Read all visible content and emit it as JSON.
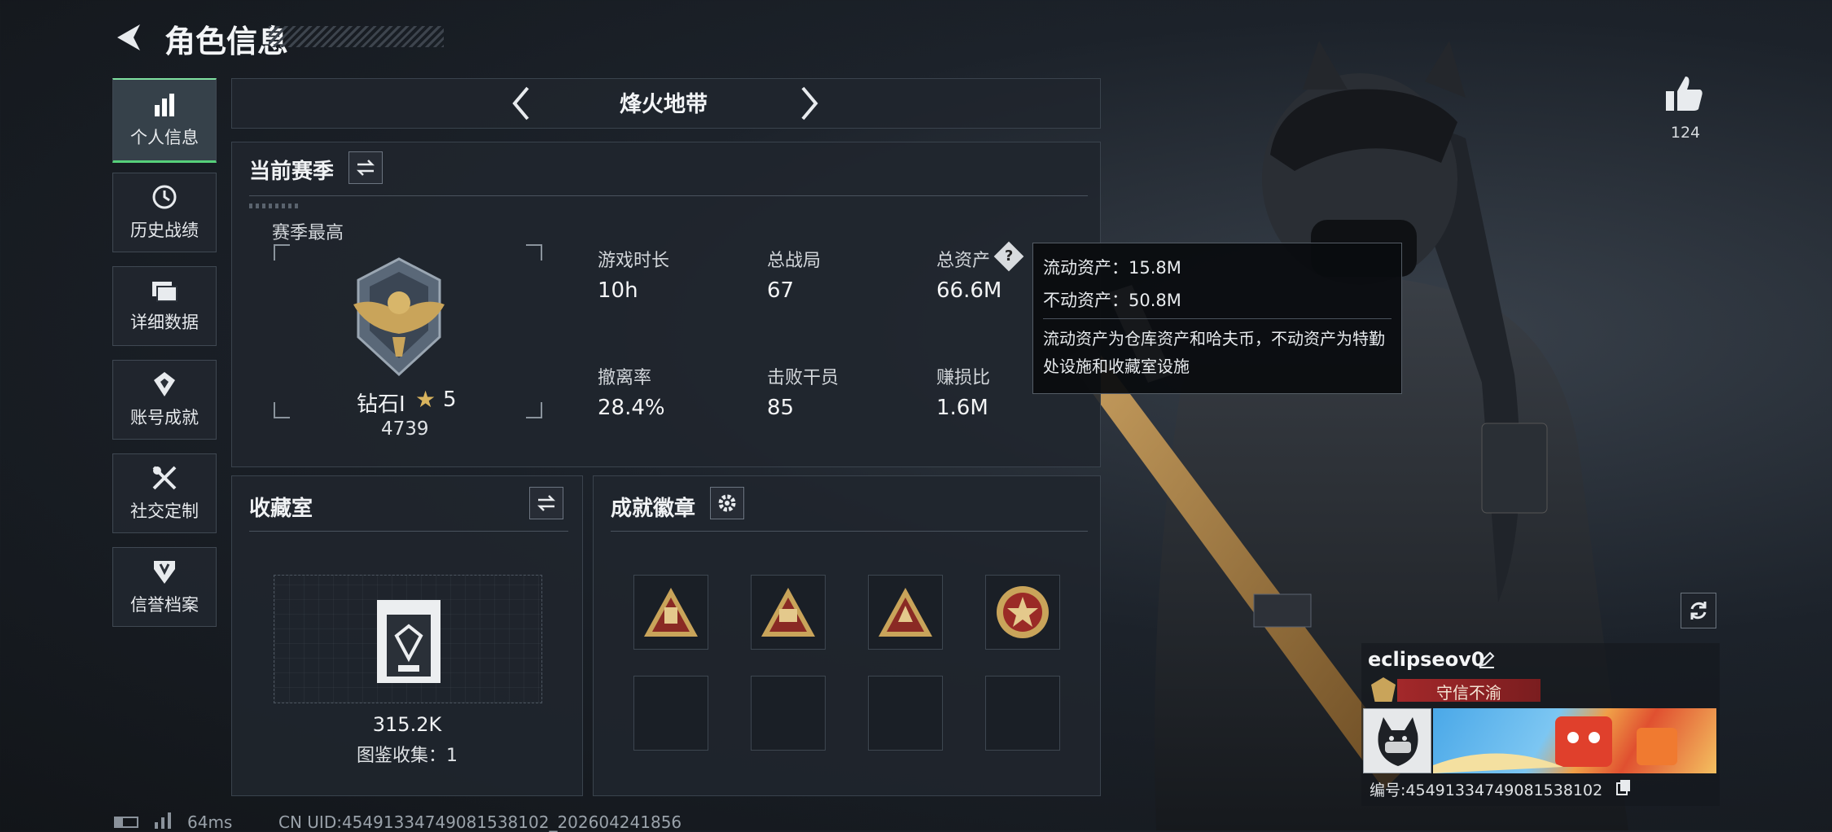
{
  "header": {
    "title": "角色信息"
  },
  "sidebar": {
    "items": [
      {
        "label": "个人信息",
        "icon": "bar-chart-icon",
        "active": true
      },
      {
        "label": "历史战绩",
        "icon": "history-icon"
      },
      {
        "label": "详细数据",
        "icon": "folder-icon"
      },
      {
        "label": "账号成就",
        "icon": "achievement-icon"
      },
      {
        "label": "社交定制",
        "icon": "tools-icon"
      },
      {
        "label": "信誉档案",
        "icon": "shield-icon"
      }
    ]
  },
  "mode_selector": {
    "label": "烽火地带"
  },
  "season": {
    "title": "当前赛季",
    "peak_label": "赛季最高",
    "rank": "钻石Ⅰ",
    "stars": "5",
    "score": "4739",
    "stats": [
      {
        "label": "游戏时长",
        "value": "10h"
      },
      {
        "label": "总战局",
        "value": "67"
      },
      {
        "label": "总资产",
        "value": "66.6M"
      },
      {
        "label": "撤离率",
        "value": "28.4%"
      },
      {
        "label": "击败干员",
        "value": "85"
      },
      {
        "label": "赚损比",
        "value": "1.6M"
      }
    ]
  },
  "tooltip": {
    "liquid": "流动资产：15.8M",
    "fixed": "不动资产：50.8M",
    "desc": "流动资产为仓库资产和哈夫币，不动资产为特勤处设施和收藏室设施"
  },
  "collection": {
    "title": "收藏室",
    "value": "315.2K",
    "count_label": "图鉴收集：1"
  },
  "badges": {
    "title": "成就徽章"
  },
  "likes": {
    "count": "124"
  },
  "player": {
    "name": "eclipseov0",
    "title": "守信不渝",
    "id_label": "编号:45491334749081538102"
  },
  "footer": {
    "ping": "64ms",
    "uid": "CN UID:45491334749081538102_202604241856"
  },
  "colors": {
    "accent_green": "#56d07a",
    "title_red": "#a3282a",
    "bg": "#1c222a"
  }
}
